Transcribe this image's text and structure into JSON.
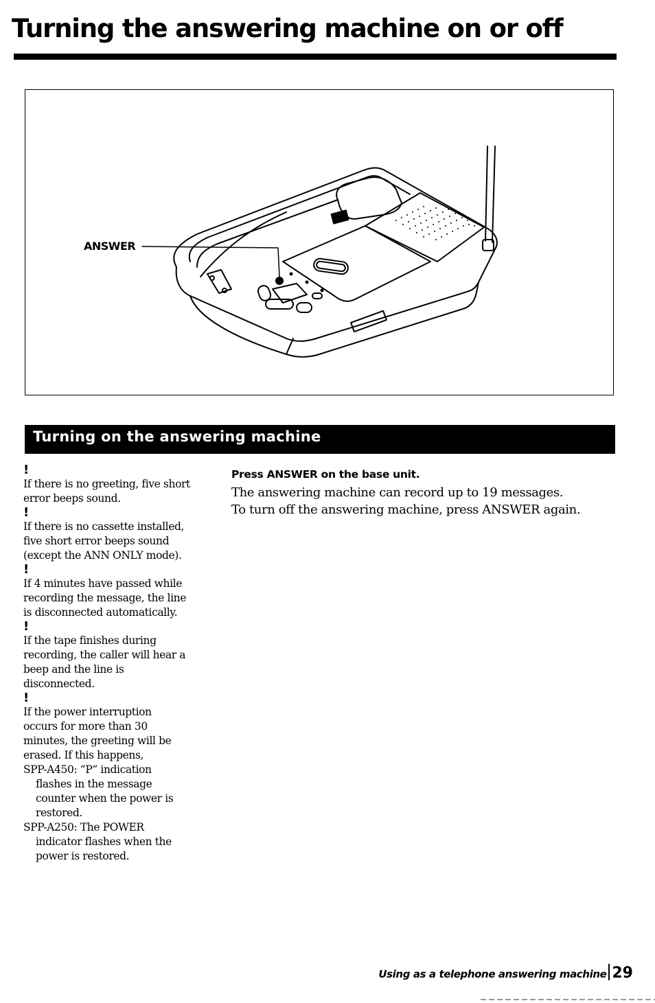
{
  "page": {
    "title": "Turning the answering machine on or off",
    "figure": {
      "callout_label": "ANSWER",
      "description": "Base unit of cordless telephone with answering machine; ANSWER button indicated"
    },
    "section": {
      "title": "Turning on the answering machine",
      "step": {
        "heading": "Press ANSWER on the base unit.",
        "body": [
          "The answering machine can record up to 19 messages.",
          "To turn off the answering machine, press ANSWER again."
        ]
      },
      "notes": [
        {
          "mark": "!",
          "lines": [
            {
              "text": "If there is no greeting, five short",
              "indent": false
            },
            {
              "text": "error beeps sound.",
              "indent": false
            }
          ]
        },
        {
          "mark": "!",
          "lines": [
            {
              "text": "If there is no cassette installed,",
              "indent": false
            },
            {
              "text": "five short error beeps sound",
              "indent": false
            },
            {
              "text": "(except the ANN ONLY mode).",
              "indent": false
            }
          ]
        },
        {
          "mark": "!",
          "lines": [
            {
              "text": "If 4 minutes have passed while",
              "indent": false
            },
            {
              "text": "recording the message, the line",
              "indent": false
            },
            {
              "text": "is disconnected automatically.",
              "indent": false
            }
          ]
        },
        {
          "mark": "!",
          "lines": [
            {
              "text": "If the tape finishes during",
              "indent": false
            },
            {
              "text": "recording, the caller will hear a",
              "indent": false
            },
            {
              "text": "beep and the line is",
              "indent": false
            },
            {
              "text": "disconnected.",
              "indent": false
            }
          ]
        },
        {
          "mark": "!",
          "lines": [
            {
              "text": "If the power interruption",
              "indent": false
            },
            {
              "text": "occurs for more than 30",
              "indent": false
            },
            {
              "text": "minutes, the greeting will be",
              "indent": false
            },
            {
              "text": "erased.  If this happens,",
              "indent": false
            },
            {
              "text": "SPP-A450: “P” indication",
              "indent": false
            },
            {
              "text": "flashes in the message",
              "indent": true
            },
            {
              "text": "counter when the power is",
              "indent": true
            },
            {
              "text": "restored.",
              "indent": true
            },
            {
              "text": "SPP-A250: The POWER",
              "indent": false
            },
            {
              "text": "indicator flashes when the",
              "indent": true
            },
            {
              "text": "power is restored.",
              "indent": true
            }
          ]
        }
      ]
    },
    "footer": {
      "section_name": "Using as a telephone answering machine",
      "page_number": "29"
    }
  }
}
